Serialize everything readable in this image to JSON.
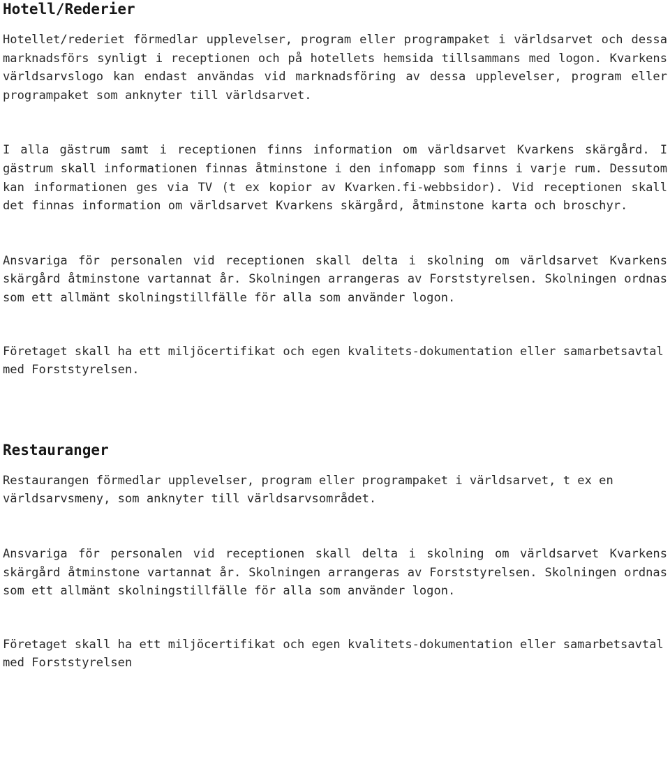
{
  "document": {
    "page_background": "#ffffff",
    "text_color": "#2b2b2b",
    "heading_color": "#171717",
    "sections": [
      {
        "heading": "Hotell/Rederier",
        "paragraphs": [
          "Hotellet/rederiet förmedlar upplevelser, program eller programpaket i världsarvet och dessa marknadsförs synligt i receptionen och på hotellets hemsida tillsammans med logon. Kvarkens världsarvslogo kan endast användas vid marknadsföring av dessa upplevelser, program eller programpaket som anknyter till världsarvet.",
          "I alla gästrum samt i receptionen finns information om världsarvet Kvarkens skärgård. I gästrum skall informationen finnas åtminstone i den infomapp som finns i varje rum. Dessutom kan informationen ges via TV (t ex kopior av Kvarken.fi-webbsidor). Vid receptionen skall det finnas information om världsarvet Kvarkens skärgård, åtminstone karta och broschyr.",
          "Ansvariga för personalen vid receptionen skall delta i skolning om världsarvet Kvarkens skärgård åtminstone vartannat år. Skolningen arrangeras av Forststyrelsen. Skolningen ordnas som ett allmänt skolningstillfälle för alla som använder logon.",
          "Företaget skall ha ett miljöcertifikat och egen kvalitets-dokumentation eller samarbetsavtal med Forststyrelsen."
        ]
      },
      {
        "heading": "Restauranger",
        "paragraphs": [
          "Restaurangen förmedlar upplevelser, program eller programpaket i världsarvet, t ex en världsarvsmeny, som anknyter till världsarvsområdet.",
          "Ansvariga för personalen vid receptionen skall delta i skolning om världsarvet Kvarkens skärgård åtminstone vartannat år. Skolningen arrangeras av Forststyrelsen. Skolningen ordnas som ett allmänt skolningstillfälle för alla som använder logon.",
          "Företaget skall ha ett miljöcertifikat och egen kvalitets-dokumentation eller samarbetsavtal med Forststyrelsen"
        ]
      }
    ]
  }
}
